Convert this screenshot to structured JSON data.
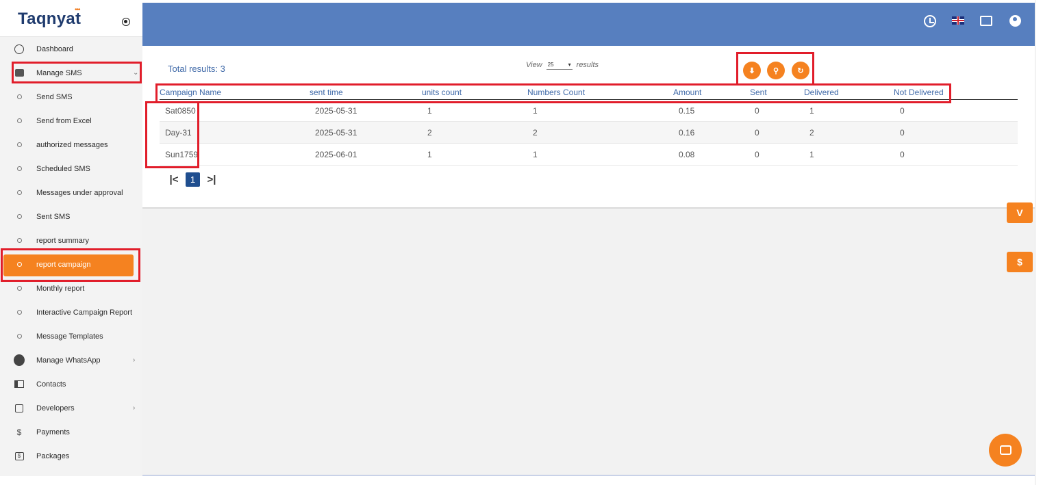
{
  "app": {
    "logo_text": "Taqnyat",
    "logo_dots": "•••"
  },
  "sidebar": {
    "items": [
      {
        "label": "Dashboard",
        "icon": "dashboard-icon"
      },
      {
        "label": "Manage SMS",
        "icon": "sms-icon",
        "chevron": "⌄"
      },
      {
        "label": "Send SMS"
      },
      {
        "label": "Send from Excel"
      },
      {
        "label": "authorized messages"
      },
      {
        "label": "Scheduled SMS"
      },
      {
        "label": "Messages under approval"
      },
      {
        "label": "Sent SMS"
      },
      {
        "label": "report summary"
      },
      {
        "label": "report campaign",
        "active": true
      },
      {
        "label": "Monthly report"
      },
      {
        "label": "Interactive Campaign Report"
      },
      {
        "label": "Message Templates"
      },
      {
        "label": "Manage WhatsApp",
        "icon": "whatsapp-icon",
        "chevron": "›"
      },
      {
        "label": "Contacts",
        "icon": "contacts-icon"
      },
      {
        "label": "Developers",
        "icon": "developers-icon",
        "chevron": "›"
      },
      {
        "label": "Payments",
        "icon": "payments-icon",
        "glyph": "$"
      },
      {
        "label": "Packages",
        "icon": "packages-icon",
        "glyph": "$"
      }
    ]
  },
  "header": {
    "icons": [
      "clock-icon",
      "uk-flag-icon",
      "fullscreen-icon",
      "user-account-icon"
    ]
  },
  "report": {
    "total_label": "Total results: 3",
    "view_label": "View",
    "view_value": "25",
    "results_label": "results",
    "actions": [
      "download-icon",
      "search-icon",
      "refresh-icon"
    ],
    "columns": [
      "Campaign Name",
      "sent time",
      "units count",
      "Numbers Count",
      "Amount",
      "Sent",
      "Delivered",
      "Not Delivered"
    ],
    "rows": [
      [
        "Sat0850",
        "2025-05-31",
        "1",
        "1",
        "0.15",
        "0",
        "1",
        "0"
      ],
      [
        "Day-31",
        "2025-05-31",
        "2",
        "2",
        "0.16",
        "0",
        "2",
        "0"
      ],
      [
        "Sun1759",
        "2025-06-01",
        "1",
        "1",
        "0.08",
        "0",
        "1",
        "0"
      ]
    ],
    "pagination": {
      "first": "|<",
      "current": "1",
      "last": ">|"
    }
  },
  "floating": {
    "top_glyph": "V",
    "dollar_glyph": "$"
  },
  "colors": {
    "accent": "#f58220",
    "header": "#577fbf",
    "link": "#3f69a8",
    "annotation": "#e11d2a"
  }
}
